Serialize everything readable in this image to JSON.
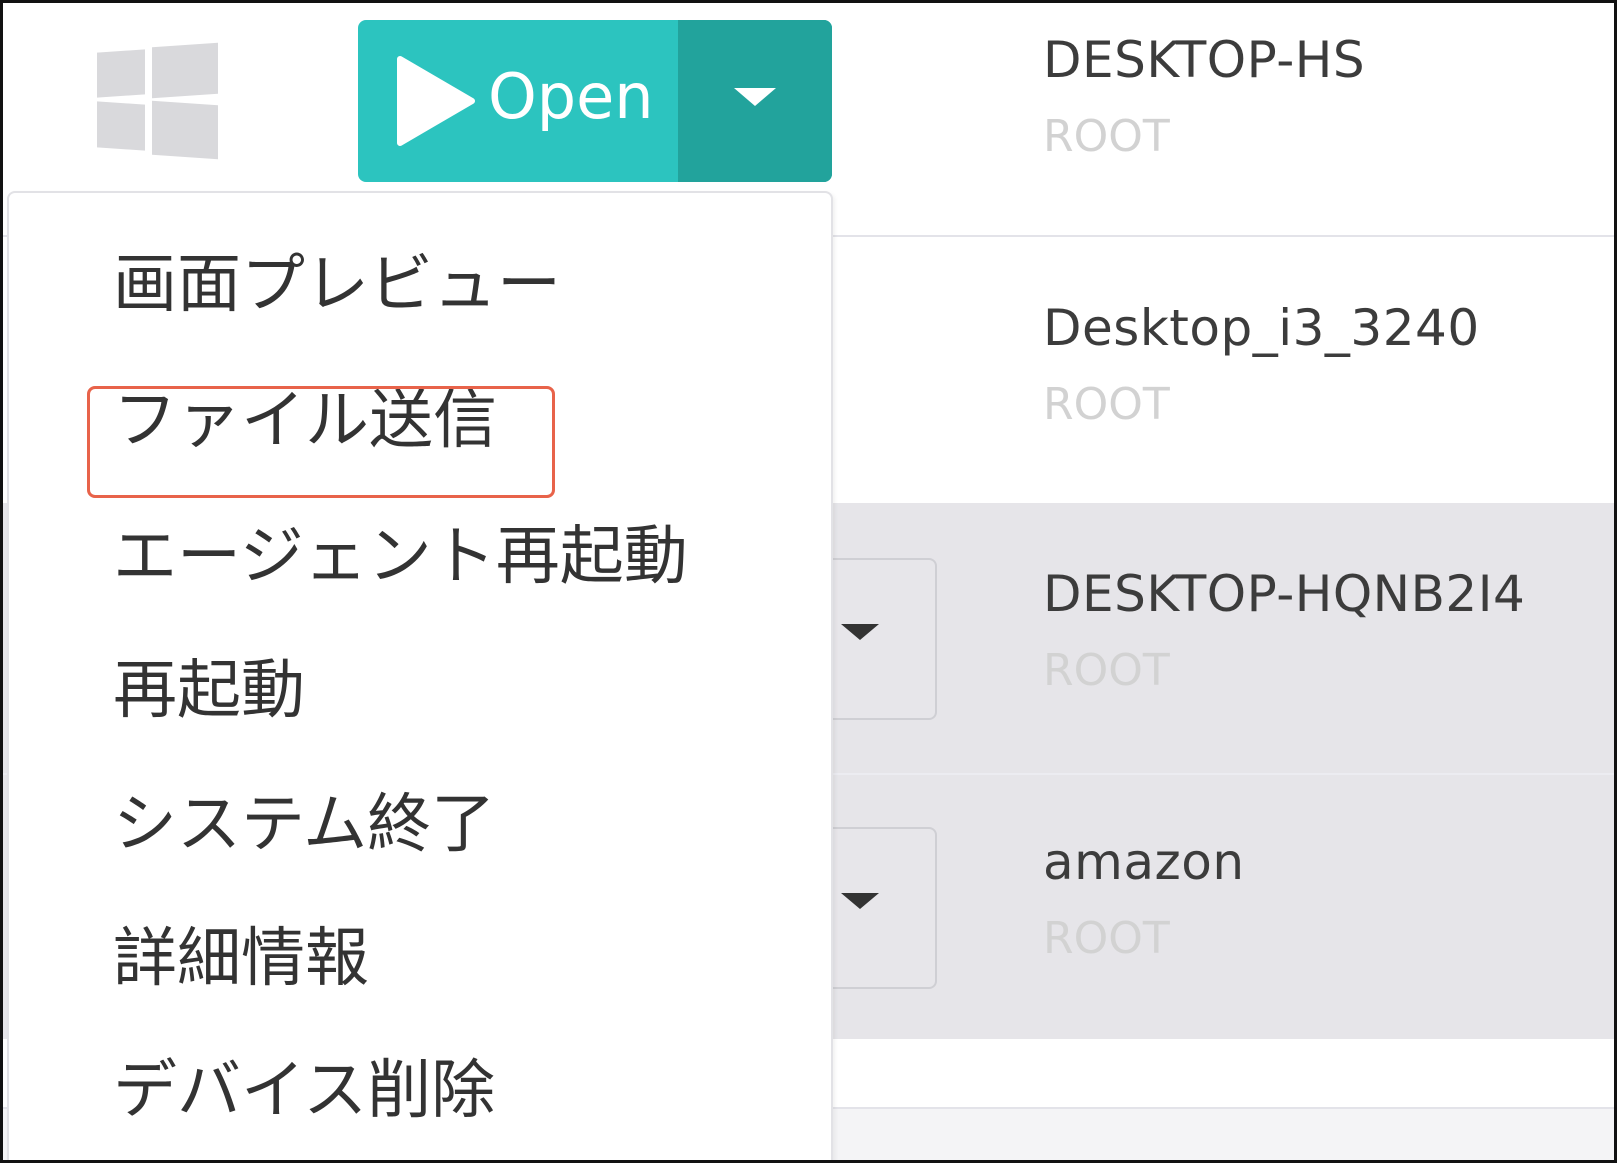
{
  "toolbar": {
    "os_icon": "windows-logo-icon",
    "open_button": {
      "label": "Open",
      "icon": "play-icon",
      "caret_icon": "chevron-down-icon",
      "color": "#2cc4bf",
      "caret_color": "#22a39c"
    }
  },
  "context_menu": {
    "items": [
      "画面プレビュー",
      "ファイル送信",
      "エージェント再起動",
      "再起動",
      "システム終了",
      "詳細情報",
      "デバイス削除"
    ],
    "highlighted_item": "ファイル送信",
    "highlight_color": "#e8634a"
  },
  "devices": [
    {
      "name": "DESKTOP-HS",
      "group": "ROOT"
    },
    {
      "name": "Desktop_i3_3240",
      "group": "ROOT"
    },
    {
      "name": "DESKTOP-HQNB2I4",
      "group": "ROOT"
    },
    {
      "name": "amazon",
      "group": "ROOT"
    }
  ],
  "colors": {
    "selected_row_bg": "#e6e5e9",
    "group_text": "#d2d2d2"
  }
}
